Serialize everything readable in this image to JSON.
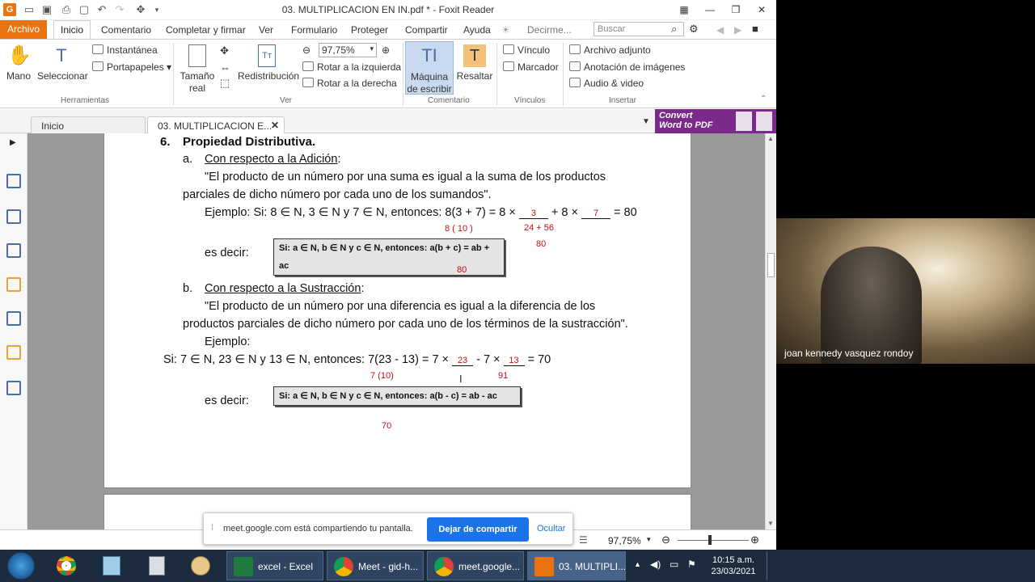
{
  "window": {
    "title": "03. MULTIPLICACION EN IN.pdf * - Foxit Reader",
    "tell_me": "Decirme...",
    "search_placeholder": "Buscar"
  },
  "menu": [
    "Archivo",
    "Inicio",
    "Comentario",
    "Completar y firmar",
    "Ver",
    "Formulario",
    "Proteger",
    "Compartir",
    "Ayuda"
  ],
  "ribbon": {
    "mano": "Mano",
    "seleccionar": "Seleccionar",
    "instantanea": "Instantánea",
    "portapapeles": "Portapapeles",
    "herramientas": "Herramientas",
    "tamano_real_1": "Tamaño",
    "tamano_real_2": "real",
    "redistribucion": "Redistribución",
    "zoom": "97,75%",
    "rotar_izq": "Rotar a la izquierda",
    "rotar_der": "Rotar a la derecha",
    "ver": "Ver",
    "maquina_1": "Máquina",
    "maquina_2": "de escribir",
    "resaltar": "Resaltar",
    "comentario": "Comentario",
    "vinculo": "Vínculo",
    "marcador": "Marcador",
    "vinculos": "Vínculos",
    "archivo_adjunto": "Archivo adjunto",
    "anotacion_imagenes": "Anotación de imágenes",
    "audio_video": "Audio & video",
    "insertar": "Insertar"
  },
  "tabs": [
    {
      "label": "Inicio"
    },
    {
      "label": "03. MULTIPLICACION E..."
    }
  ],
  "convert": {
    "line1": "Convert",
    "line2": "Word to PDF"
  },
  "doc": {
    "heading_num": "6.",
    "heading": "Propiedad Distributiva.",
    "a_mark": "a.",
    "a_title": "Con respecto a la Adición",
    "a_quote_1": "\"El producto de un número por una suma es igual a la suma de los productos",
    "a_quote_2": "parciales de dicho número por cada uno de los sumandos\".",
    "a_example_1": "Ejemplo: Si: 8 ∈ N, 3 ∈ N y 7 ∈ N, entonces: 8(3 + 7) = 8 × ",
    "a_blank_1": "3",
    "a_example_2": " + 8 × ",
    "a_blank_2": "7",
    "a_example_3": " = 80",
    "a_hw_1": "8 ( 10 )",
    "a_hw_2": "24 + 56",
    "a_hw_3": "80",
    "a_es_decir": "es decir:",
    "a_box": "Si: a ∈ N, b ∈ N y c ∈ N, entonces: a(b + c) = ab + ac",
    "a_hw_4": "80",
    "b_mark": "b.",
    "b_title": "Con respecto a la Sustracción",
    "b_quote_1": "\"El producto de un número por una diferencia es igual a la diferencia de los",
    "b_quote_2": "productos parciales de dicho número por cada uno de los términos de la sustracción\".",
    "b_ejemplo": "Ejemplo:",
    "b_example_1": "Si: 7 ∈ N, 23 ∈ N y 13 ∈ N, entonces: 7(23 - 13) = 7 × ",
    "b_blank_1": "23",
    "b_example_2": " - 7 × ",
    "b_blank_2": "13",
    "b_example_3": " = 70",
    "b_hw_1": "7 (10)",
    "b_hw_2": "91",
    "b_es_decir": "es decir:",
    "b_box": "Si: a ∈ N, b ∈ N y c ∈ N, entonces: a(b - c) = ab - ac",
    "b_hw_3": "70"
  },
  "statusbar": {
    "zoom": "97,75%"
  },
  "share": {
    "message": "meet.google.com está compartiendo tu pantalla.",
    "stop": "Dejar de compartir",
    "hide": "Ocultar"
  },
  "video": {
    "participant": "joan kennedy vasquez rondoy"
  },
  "taskbar": {
    "apps": [
      "excel - Excel",
      "Meet - gid-h...",
      "meet.google...",
      "03. MULTIPLI..."
    ],
    "time": "10:15 a.m.",
    "date": "23/03/2021"
  },
  "colors": {
    "accent": "#e9730f",
    "convert": "#7b2a8c",
    "meet_blue": "#1a73e8",
    "handwriting": "#c01010"
  }
}
